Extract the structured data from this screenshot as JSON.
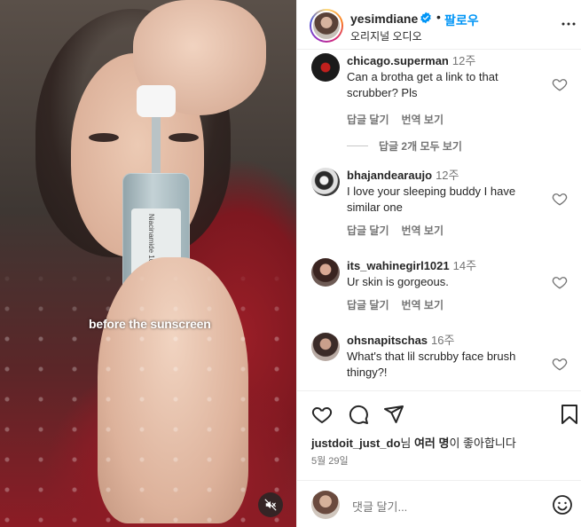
{
  "video": {
    "caption": "before the sunscreen",
    "bottle_label": "Niacinamide 10% Serum"
  },
  "header": {
    "username": "yesimdiane",
    "dot": "•",
    "follow_label": "팔로우",
    "audio_label": "오리지널 오디오"
  },
  "comments": [
    {
      "username": "chicago.superman",
      "time": "12주",
      "text": "Can a brotha get a link to that scrubber? Pls",
      "reply_label": "답글 달기",
      "translate_label": "번역 보기",
      "view_replies": "답글 2개 모두 보기"
    },
    {
      "username": "bhajandearaujo",
      "time": "12주",
      "text": "I love your sleeping buddy I have similar one",
      "reply_label": "답글 달기",
      "translate_label": "번역 보기"
    },
    {
      "username": "its_wahinegirl1021",
      "time": "14주",
      "text": "Ur skin is gorgeous.",
      "reply_label": "답글 달기",
      "translate_label": "번역 보기"
    },
    {
      "username": "ohsnapitschas",
      "time": "16주",
      "text": "What's that lil scrubby face brush thingy?!"
    }
  ],
  "footer": {
    "liked_by_user": "justdoit_just_do",
    "liked_by_mid": "님 ",
    "liked_by_others": "여러 명",
    "liked_by_suffix": "이 좋아합니다",
    "date": "5월 29일",
    "comment_placeholder": "댓글 달기..."
  },
  "colors": {
    "accent_blue": "#0095f6",
    "text_primary": "#262626",
    "text_secondary": "#737373"
  }
}
